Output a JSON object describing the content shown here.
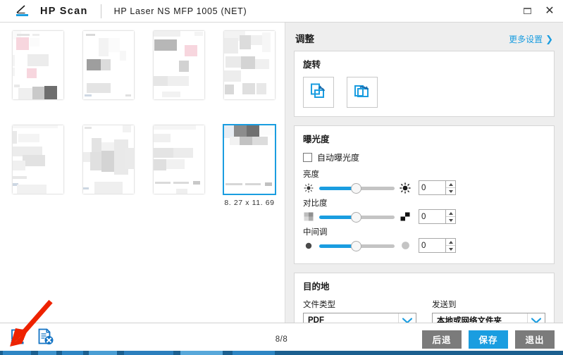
{
  "titlebar": {
    "logo_icon": "scanner-logo-icon",
    "brand": "HP Scan",
    "device": "HP Laser NS MFP 1005 (NET)",
    "minimize_icon": "minimize-icon",
    "close_icon": "close-icon"
  },
  "thumbnails": {
    "selected_index": 7,
    "selected_dimensions": "8. 27  x  11. 69",
    "pages": [
      {
        "id": "page-1"
      },
      {
        "id": "page-2"
      },
      {
        "id": "page-3"
      },
      {
        "id": "page-4"
      },
      {
        "id": "page-5"
      },
      {
        "id": "page-6"
      },
      {
        "id": "page-7"
      },
      {
        "id": "page-8"
      }
    ]
  },
  "settings": {
    "title": "调整",
    "more_settings": "更多设置",
    "more_settings_icon": "chevron-right-icon",
    "rotate": {
      "title": "旋转",
      "left_icon": "rotate-left-icon",
      "right_icon": "rotate-right-icon"
    },
    "exposure": {
      "title": "曝光度",
      "auto_label": "自动曝光度",
      "auto_checked": false,
      "brightness": {
        "label": "亮度",
        "value": "0",
        "slider_percent": 50,
        "low_icon": "brightness-low-icon",
        "high_icon": "brightness-high-icon"
      },
      "contrast": {
        "label": "对比度",
        "value": "0",
        "slider_percent": 50,
        "low_icon": "contrast-low-icon",
        "high_icon": "contrast-high-icon"
      },
      "midtones": {
        "label": "中间调",
        "value": "0",
        "slider_percent": 50,
        "low_icon": "midtone-dark-icon",
        "high_icon": "midtone-light-icon"
      }
    },
    "destination": {
      "title": "目的地",
      "file_type_label": "文件类型",
      "file_type_value": "PDF",
      "send_to_label": "发送到",
      "send_to_value": "本地或网络文件夹",
      "dropdown_icon": "chevron-down-icon"
    }
  },
  "bottombar": {
    "add_scan_icon": "add-scan-icon",
    "delete_page_icon": "delete-page-icon",
    "page_counter": "8/8",
    "back_label": "后退",
    "save_label": "保存",
    "exit_label": "退出"
  },
  "annotation": {
    "arrow_icon": "red-arrow-annotation",
    "color": "#ee2200"
  },
  "colors": {
    "accent_blue": "#1a9de0",
    "panel_bg": "#eeeeee",
    "button_gray": "#7b7b7b"
  }
}
